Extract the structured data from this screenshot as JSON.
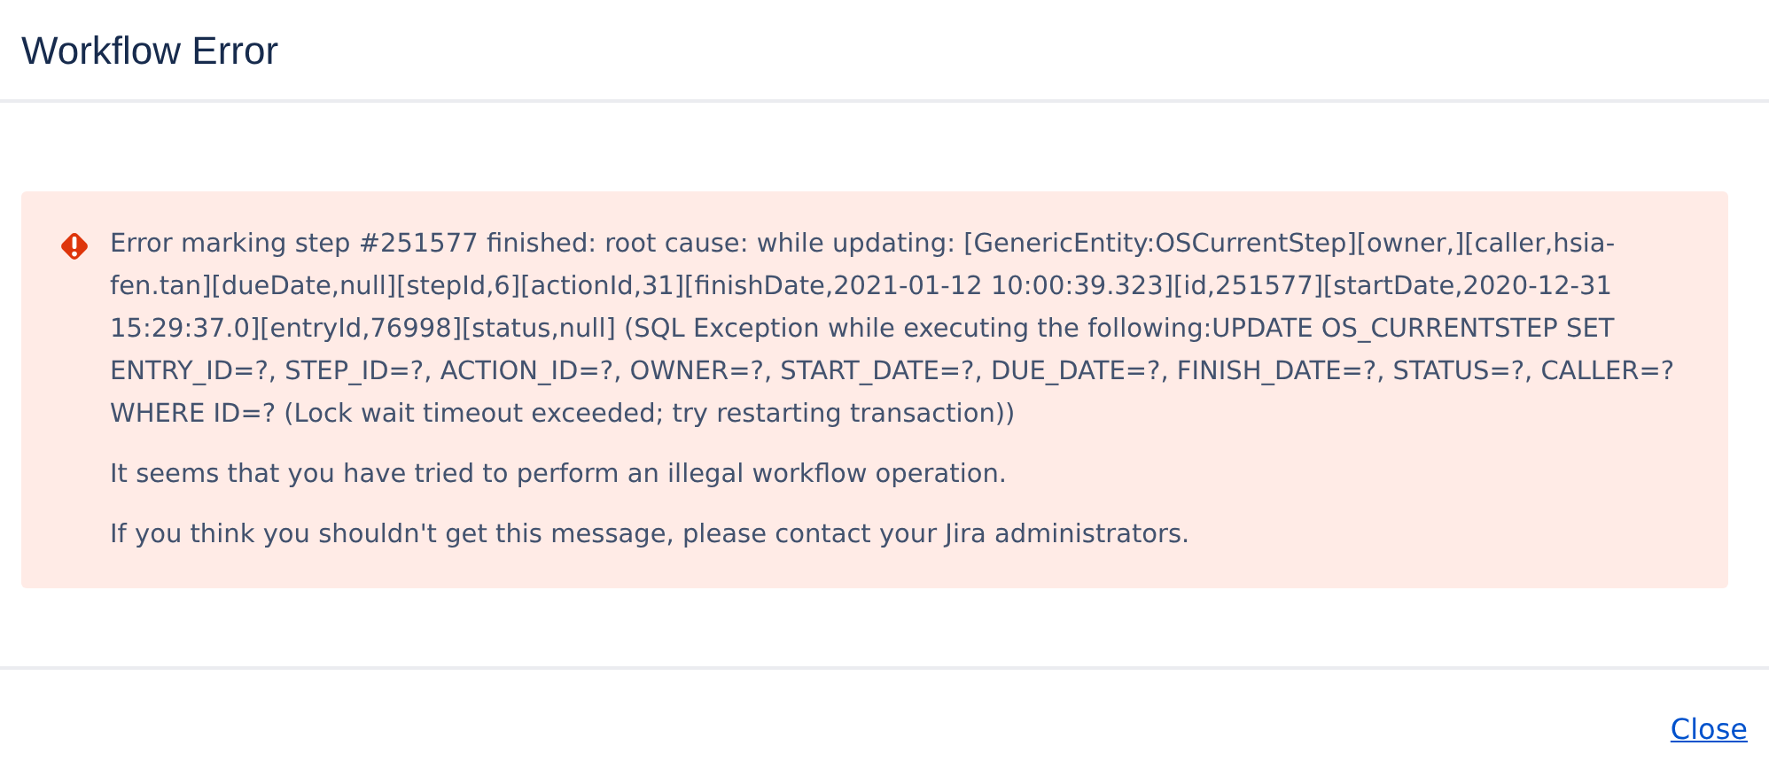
{
  "dialog": {
    "title": "Workflow Error",
    "error": {
      "paragraphs": [
        "Error marking step #251577 finished: root cause: while updating: [GenericEntity:OSCurrentStep][owner,][caller,hsia-fen.tan][dueDate,null][stepId,6][actionId,31][finishDate,2021-01-12 10:00:39.323][id,251577][startDate,2020-12-31 15:29:37.0][entryId,76998][status,null] (SQL Exception while executing the following:UPDATE OS_CURRENTSTEP SET ENTRY_ID=?, STEP_ID=?, ACTION_ID=?, OWNER=?, START_DATE=?, DUE_DATE=?, FINISH_DATE=?, STATUS=?, CALLER=? WHERE ID=? (Lock wait timeout exceeded; try restarting transaction))",
        "It seems that you have tried to perform an illegal workflow operation.",
        "If you think you shouldn't get this message, please contact your Jira administrators."
      ]
    },
    "close_link": "Close"
  }
}
